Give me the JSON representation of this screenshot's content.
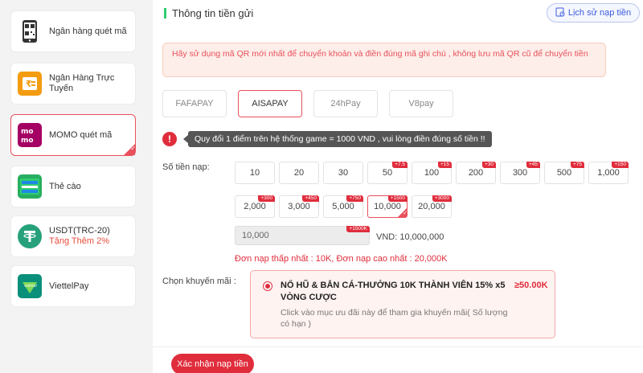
{
  "sidebar": {
    "items": [
      {
        "label": "Ngân hàng quét mã",
        "sub": "",
        "icon": "qr-phone-icon"
      },
      {
        "label": "Ngân Hàng Trực Tuyến",
        "sub": "",
        "icon": "online-bank-icon"
      },
      {
        "label": "MOMO quét mã",
        "sub": "",
        "icon": "momo-icon"
      },
      {
        "label": "Thẻ cào",
        "sub": "",
        "icon": "scratch-card-icon"
      },
      {
        "label": "USDT(TRC-20)",
        "sub": "Tặng Thêm 2%",
        "icon": "tether-icon"
      },
      {
        "label": "ViettelPay",
        "sub": "",
        "icon": "viettelpay-icon"
      }
    ],
    "active_index": 2
  },
  "header": {
    "title": "Thông tin tiền gửi",
    "history_label": "Lịch sử nạp tiền"
  },
  "notice": "Hãy sử dụng mã QR mới nhất để chuyển khoản và điền đúng mã ghi chú , không lưu mã QR cũ để chuyển tiền",
  "channels": [
    {
      "label": "FAFAPAY",
      "active": false
    },
    {
      "label": "AISAPAY",
      "active": true
    },
    {
      "label": "24hPay",
      "active": false
    },
    {
      "label": "V8pay",
      "active": false
    }
  ],
  "rate_info": "Quy đổi 1 điểm trên hệ thống game = 1000 VND , vui lòng điền đúng số tiền !!",
  "amount_label": "Số tiền nạp:",
  "amounts_row1": [
    {
      "value": "10",
      "bonus": ""
    },
    {
      "value": "20",
      "bonus": ""
    },
    {
      "value": "30",
      "bonus": ""
    },
    {
      "value": "50",
      "bonus": "+7.5"
    },
    {
      "value": "100",
      "bonus": "+15"
    },
    {
      "value": "200",
      "bonus": "+30"
    },
    {
      "value": "300",
      "bonus": "+45"
    },
    {
      "value": "500",
      "bonus": "+75"
    },
    {
      "value": "1,000",
      "bonus": "+150"
    }
  ],
  "amounts_row2": [
    {
      "value": "2,000",
      "bonus": "+300"
    },
    {
      "value": "3,000",
      "bonus": "+450"
    },
    {
      "value": "5,000",
      "bonus": "+750"
    },
    {
      "value": "10,000",
      "bonus": "+1500"
    },
    {
      "value": "20,000",
      "bonus": "+3000"
    }
  ],
  "selected_amount": "10,000",
  "amount_input": {
    "value": "10,000",
    "bonus": "+1500K"
  },
  "vnd_text": "VND: 10,000,000",
  "limits": {
    "min_label": "Đơn nạp thấp nhất :",
    "min_value": "10K",
    "max_label": "Đơn nạp cao nhất :",
    "max_value": "20,000K"
  },
  "promo_label": "Chọn khuyến mãi :",
  "promo": {
    "title": "NỔ HŨ & BẮN CÁ-THƯỞNG 10K THÀNH VIÊN 15% x5 VÒNG CƯỢC",
    "amount": "≥50.00K",
    "desc": "Click vào mục ưu đãi này để tham gia khuyến mãi( Số lượng có hạn )"
  },
  "confirm_label": "Xác nhận nạp tiền",
  "colors": {
    "accent": "#e02d3c",
    "green": "#2ecc71",
    "link_blue": "#3b5bdb"
  }
}
